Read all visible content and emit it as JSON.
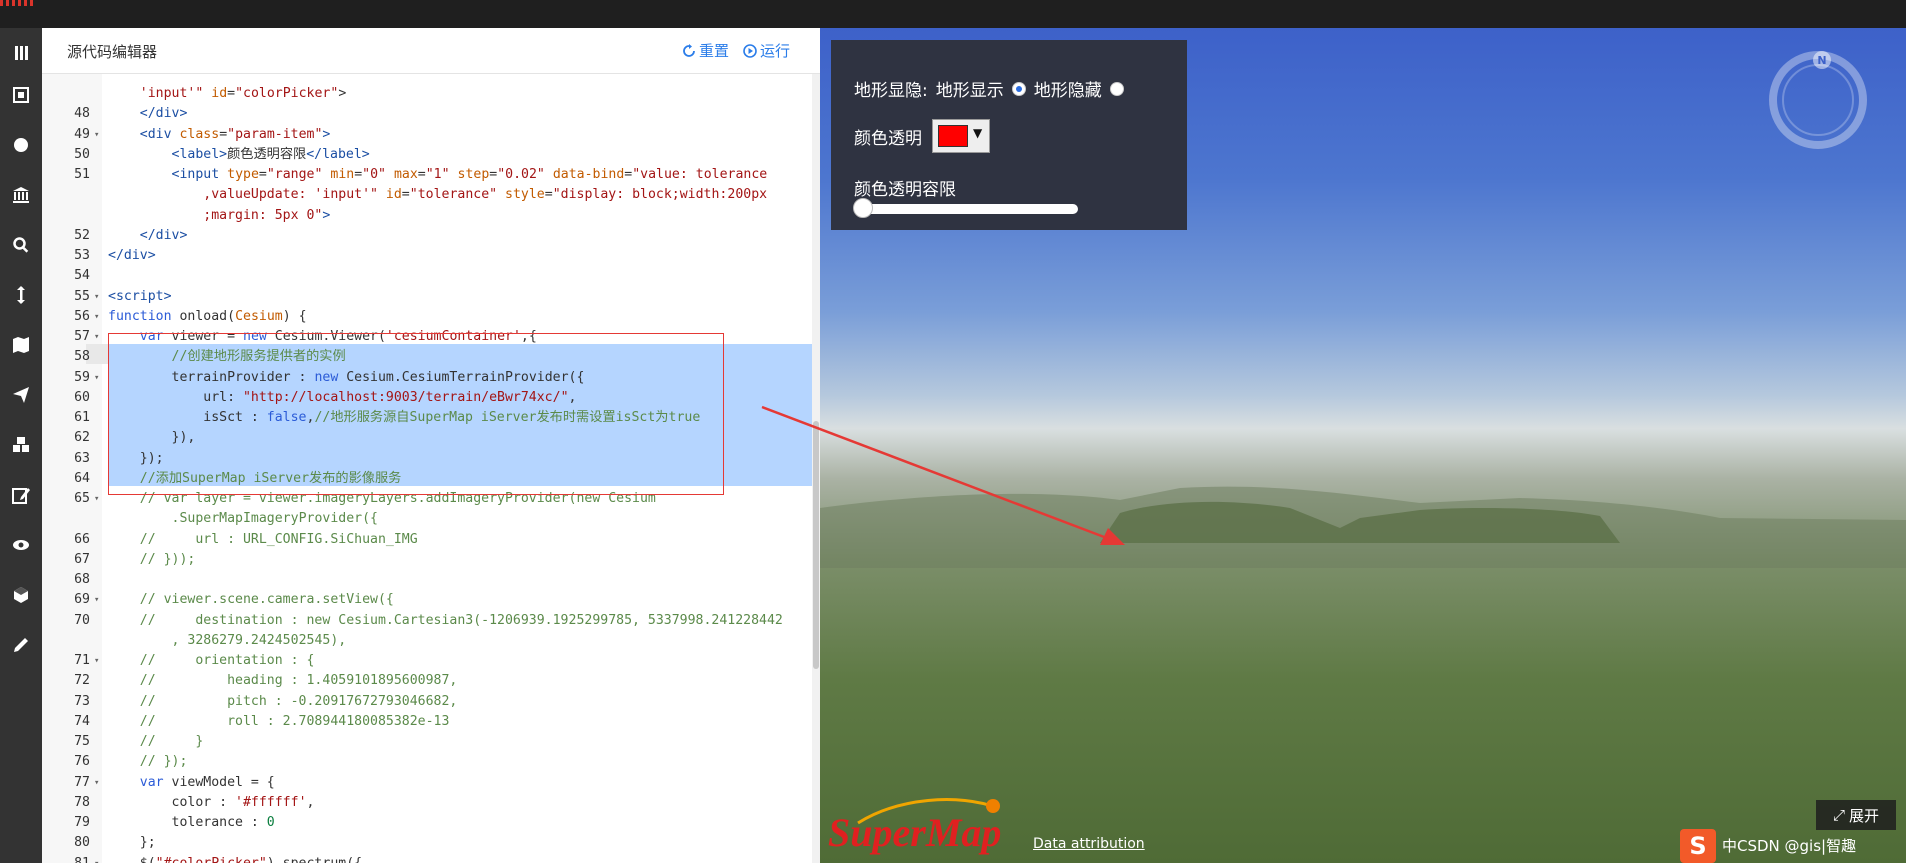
{
  "editor": {
    "title": "源代码编辑器",
    "reset_label": "重置",
    "run_label": "运行"
  },
  "code_lines": [
    {
      "num": "",
      "fold": "",
      "html": "    <span class='t-str'>'input'\"</span> <span class='t-attr'>id</span>=<span class='t-str'>\"colorPicker\"</span>>"
    },
    {
      "num": "48",
      "fold": "",
      "html": "    <span class='t-tag'>&lt;/div&gt;</span>"
    },
    {
      "num": "49",
      "fold": "▾",
      "html": "    <span class='t-tag'>&lt;div</span> <span class='t-attr'>class</span>=<span class='t-str'>\"param-item\"</span><span class='t-tag'>&gt;</span>"
    },
    {
      "num": "50",
      "fold": "",
      "html": "        <span class='t-tag'>&lt;label&gt;</span>颜色透明容限<span class='t-tag'>&lt;/label&gt;</span>"
    },
    {
      "num": "51",
      "fold": "",
      "html": "        <span class='t-tag'>&lt;input</span> <span class='t-attr'>type</span>=<span class='t-str'>\"range\"</span> <span class='t-attr'>min</span>=<span class='t-str'>\"0\"</span> <span class='t-attr'>max</span>=<span class='t-str'>\"1\"</span> <span class='t-attr'>step</span>=<span class='t-str'>\"0.02\"</span> <span class='t-attr'>data-bind</span>=<span class='t-str'>\"value: tolerance</span>"
    },
    {
      "num": "",
      "fold": "",
      "html": "            <span class='t-str'>,valueUpdate: 'input'\"</span> <span class='t-attr'>id</span>=<span class='t-str'>\"tolerance\"</span> <span class='t-attr'>style</span>=<span class='t-str'>\"display: block;width:200px</span>"
    },
    {
      "num": "",
      "fold": "",
      "html": "            <span class='t-str'>;margin: 5px 0\"</span><span class='t-tag'>&gt;</span>"
    },
    {
      "num": "52",
      "fold": "",
      "html": "    <span class='t-tag'>&lt;/div&gt;</span>"
    },
    {
      "num": "53",
      "fold": "",
      "html": "<span class='t-tag'>&lt;/div&gt;</span>"
    },
    {
      "num": "54",
      "fold": "",
      "html": ""
    },
    {
      "num": "55",
      "fold": "▾",
      "html": "<span class='t-tag'>&lt;script&gt;</span>"
    },
    {
      "num": "56",
      "fold": "▾",
      "html": "<span class='t-kw'>function</span> onload(<span class='t-attr'>Cesium</span>) {"
    },
    {
      "num": "57",
      "fold": "▾",
      "html": "    <span class='t-kw'>var</span> viewer = <span class='t-kw'>new</span> Cesium.Viewer(<span class='t-str'>'cesiumContainer'</span>,{"
    },
    {
      "num": "58",
      "fold": "",
      "html": "        <span class='t-cm'>//创建地形服务提供者的实例</span>"
    },
    {
      "num": "59",
      "fold": "▾",
      "html": "        terrainProvider : <span class='t-kw'>new</span> Cesium.CesiumTerrainProvider({"
    },
    {
      "num": "60",
      "fold": "",
      "html": "            url: <span class='t-str'>\"http://localhost:9003/terrain/eBwr74xc/\"</span>,"
    },
    {
      "num": "61",
      "fold": "",
      "html": "            isSct : <span class='t-kw'>false</span>,<span class='t-cm'>//地形服务源自SuperMap iServer发布时需设置isSct为true</span>"
    },
    {
      "num": "62",
      "fold": "",
      "html": "        }),"
    },
    {
      "num": "63",
      "fold": "",
      "html": "    });"
    },
    {
      "num": "64",
      "fold": "",
      "html": "    <span class='t-cm'>//添加SuperMap iServer发布的影像服务</span>"
    },
    {
      "num": "65",
      "fold": "▾",
      "html": "    <span class='t-cm'>// var layer = viewer.imageryLayers.addImageryProvider(new Cesium</span>"
    },
    {
      "num": "",
      "fold": "",
      "html": "        <span class='t-cm'>.SuperMapImageryProvider({</span>"
    },
    {
      "num": "66",
      "fold": "",
      "html": "    <span class='t-cm'>//     url : URL_CONFIG.SiChuan_IMG</span>"
    },
    {
      "num": "67",
      "fold": "",
      "html": "    <span class='t-cm'>// }));</span>"
    },
    {
      "num": "68",
      "fold": "",
      "html": ""
    },
    {
      "num": "69",
      "fold": "▾",
      "html": "    <span class='t-cm'>// viewer.scene.camera.setView({</span>"
    },
    {
      "num": "70",
      "fold": "",
      "html": "    <span class='t-cm'>//     destination : new Cesium.Cartesian3(-1206939.1925299785, 5337998.241228442</span>"
    },
    {
      "num": "",
      "fold": "",
      "html": "        <span class='t-cm'>, 3286279.2424502545),</span>"
    },
    {
      "num": "71",
      "fold": "▾",
      "html": "    <span class='t-cm'>//     orientation : {</span>"
    },
    {
      "num": "72",
      "fold": "",
      "html": "    <span class='t-cm'>//         heading : 1.4059101895600987,</span>"
    },
    {
      "num": "73",
      "fold": "",
      "html": "    <span class='t-cm'>//         pitch : -0.20917672793046682,</span>"
    },
    {
      "num": "74",
      "fold": "",
      "html": "    <span class='t-cm'>//         roll : 2.708944180085382e-13</span>"
    },
    {
      "num": "75",
      "fold": "",
      "html": "    <span class='t-cm'>//     }</span>"
    },
    {
      "num": "76",
      "fold": "",
      "html": "    <span class='t-cm'>// });</span>"
    },
    {
      "num": "77",
      "fold": "▾",
      "html": "    <span class='t-kw'>var</span> viewModel = {"
    },
    {
      "num": "78",
      "fold": "",
      "html": "        color : <span class='t-str'>'#ffffff'</span>,"
    },
    {
      "num": "79",
      "fold": "",
      "html": "        tolerance : <span class='t-num'>0</span>"
    },
    {
      "num": "80",
      "fold": "",
      "html": "    };"
    },
    {
      "num": "81",
      "fold": "▾",
      "html": "    $(<span class='t-str'>\"#colorPicker\"</span>).spectrum({"
    }
  ],
  "panel": {
    "terrain_label": "地形显隐:",
    "show_label": "地形显示",
    "hide_label": "地形隐藏",
    "color_label": "颜色透明",
    "tolerance_label": "颜色透明容限",
    "color_value": "#ff0000",
    "tolerance_value": 0
  },
  "map": {
    "logo_text": "SuperMap",
    "attribution": "Data attribution",
    "expand_label": "展开",
    "compass_letter": "N",
    "watermark": "中CSDN @gis|智趣"
  }
}
